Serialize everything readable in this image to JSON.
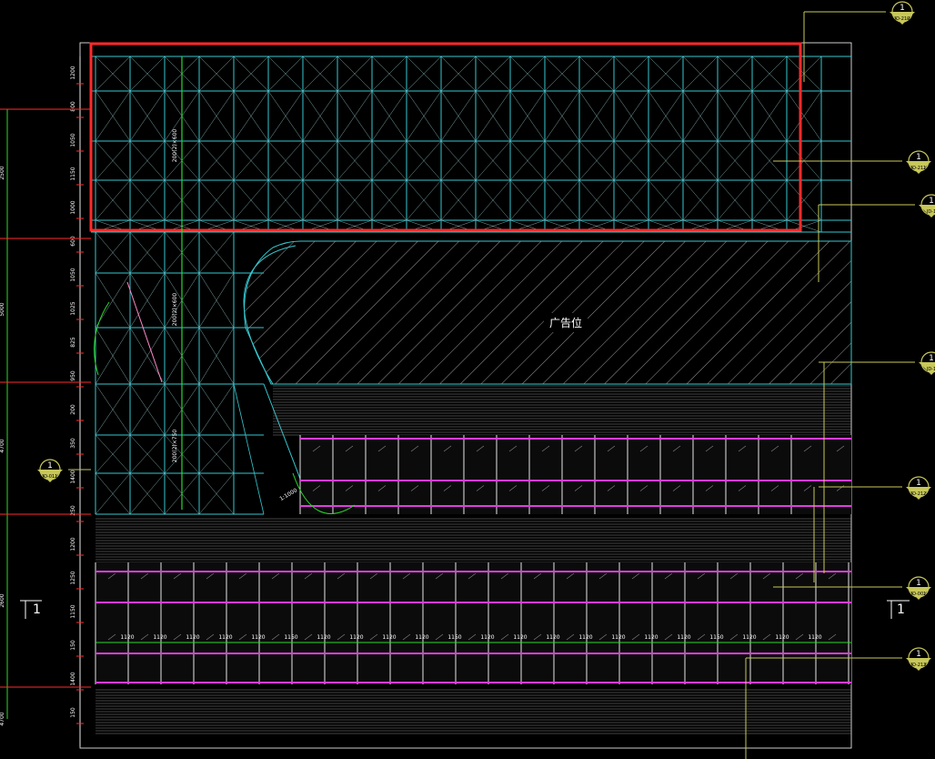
{
  "colors": {
    "background": "#000000",
    "grid": "#35c8d0",
    "highlight": "#ff2a2a",
    "dim_line": "#c7c75a",
    "magenta": "#e23ce2",
    "green": "#2bd92b",
    "white": "#ffffff",
    "stripe": "#8a8a8a",
    "hatch": "#9a9a9a"
  },
  "center_label": "广告位",
  "section_mark": "1",
  "left_dims": [
    "1200",
    "800",
    "1050",
    "1150",
    "1000",
    "600",
    "1050",
    "1025",
    "825",
    "950",
    "200",
    "350",
    "1400",
    "250",
    "1200",
    "1250",
    "1150",
    "150",
    "1400",
    "150"
  ],
  "left_vert_dims": [
    "2500",
    "5000",
    "4700",
    "2600",
    "4700"
  ],
  "vertical_notes": [
    "200(2)×600",
    "200(2)×600",
    "200(2)×750"
  ],
  "tile_dims": [
    "1120",
    "1120",
    "1120",
    "1120",
    "1120",
    "1150",
    "1120",
    "1120",
    "1120",
    "1120",
    "1150",
    "1120",
    "1120",
    "1120",
    "1120",
    "1120",
    "1120",
    "1120",
    "1150",
    "1120",
    "1120",
    "1120",
    "1120",
    "1120",
    "11211"
  ],
  "slope_note": "1:1000",
  "callouts": [
    {
      "num": "1",
      "code": "JD-210"
    },
    {
      "num": "1",
      "code": "JD-211"
    },
    {
      "num": "1",
      "code": "JD-1"
    },
    {
      "num": "1",
      "code": "JD-1"
    },
    {
      "num": "1",
      "code": "JD-212"
    },
    {
      "num": "1",
      "code": "JD-001"
    },
    {
      "num": "1",
      "code": "JD-213"
    },
    {
      "num": "1",
      "code": "JD-011"
    }
  ]
}
